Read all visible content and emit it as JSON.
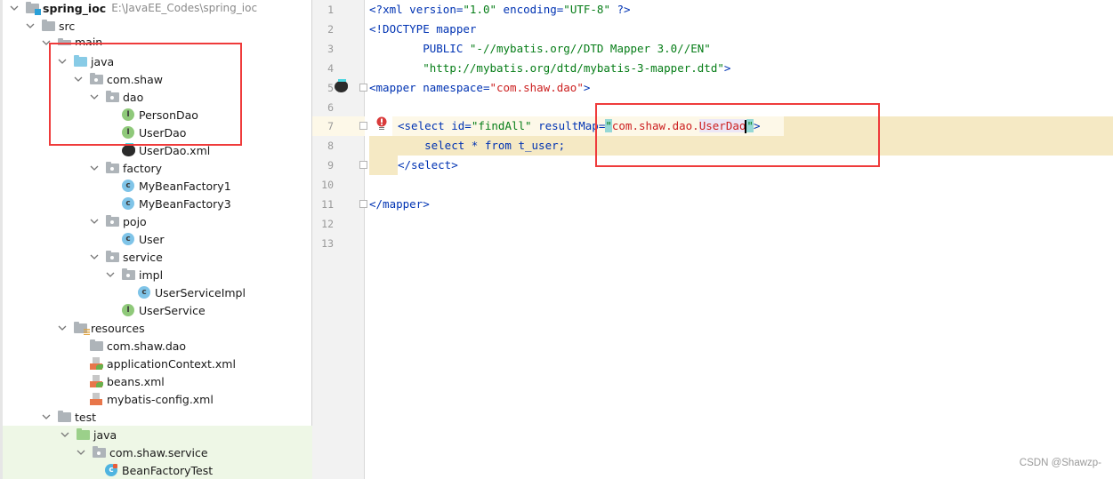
{
  "project_tree": {
    "root": {
      "name": "spring_ioc",
      "path": "E:\\JavaEE_Codes\\spring_ioc"
    },
    "items": [
      {
        "label": "src",
        "icon": "folder-icon",
        "level": 1
      },
      {
        "label": "main",
        "icon": "folder-icon",
        "level": 2
      },
      {
        "label": "java",
        "icon": "source-folder-icon",
        "level": 3
      },
      {
        "label": "com.shaw",
        "icon": "package-icon",
        "level": 4
      },
      {
        "label": "dao",
        "icon": "package-icon",
        "level": 5
      },
      {
        "label": "PersonDao",
        "icon": "interface-icon",
        "level": 6
      },
      {
        "label": "UserDao",
        "icon": "interface-icon",
        "level": 6
      },
      {
        "label": "UserDao.xml",
        "icon": "mybatis-xml-icon",
        "level": 6
      },
      {
        "label": "factory",
        "icon": "package-icon",
        "level": 5
      },
      {
        "label": "MyBeanFactory1",
        "icon": "class-icon",
        "level": 6
      },
      {
        "label": "MyBeanFactory3",
        "icon": "class-icon",
        "level": 6
      },
      {
        "label": "pojo",
        "icon": "package-icon",
        "level": 5
      },
      {
        "label": "User",
        "icon": "class-icon",
        "level": 6
      },
      {
        "label": "service",
        "icon": "package-icon",
        "level": 5
      },
      {
        "label": "impl",
        "icon": "package-icon",
        "level": 6
      },
      {
        "label": "UserServiceImpl",
        "icon": "class-icon",
        "level": 7
      },
      {
        "label": "UserService",
        "icon": "interface-icon",
        "level": 6
      },
      {
        "label": "resources",
        "icon": "resources-folder-icon",
        "level": 3
      },
      {
        "label": "com.shaw.dao",
        "icon": "folder-icon",
        "level": 4
      },
      {
        "label": "applicationContext.xml",
        "icon": "spring-xml-icon",
        "level": 4
      },
      {
        "label": "beans.xml",
        "icon": "spring-xml-icon",
        "level": 4
      },
      {
        "label": "mybatis-config.xml",
        "icon": "xml-icon",
        "level": 4
      },
      {
        "label": "test",
        "icon": "folder-icon",
        "level": 2
      },
      {
        "label": "java",
        "icon": "test-folder-icon",
        "level": 3
      },
      {
        "label": "com.shaw.service",
        "icon": "package-icon",
        "level": 4
      },
      {
        "label": "BeanFactoryTest",
        "icon": "test-class-icon",
        "level": 5
      }
    ],
    "badge_letters": {
      "interface": "I",
      "class": "c"
    }
  },
  "editor": {
    "line_numbers": [
      "1",
      "2",
      "3",
      "4",
      "5",
      "6",
      "7",
      "8",
      "9",
      "10",
      "11",
      "12",
      "13"
    ],
    "lines": {
      "l1": {
        "a": "<?",
        "b": "xml version",
        "c": "=",
        "d": "\"1.0\"",
        "e": " encoding",
        "f": "=",
        "g": "\"UTF-8\"",
        "h": " ?>"
      },
      "l2": {
        "a": "<!DOCTYPE mapper"
      },
      "l3": {
        "a": "        PUBLIC ",
        "b": "\"-//mybatis.org//DTD Mapper 3.0//EN\""
      },
      "l4": {
        "a": "        ",
        "b": "\"http://mybatis.org/dtd/mybatis-3-mapper.dtd\"",
        "c": ">"
      },
      "l5": {
        "a": "<mapper ",
        "b": "namespace",
        "c": "=",
        "d": "\"com.shaw.dao\"",
        "e": ">"
      },
      "l7": {
        "a": "<select ",
        "b": "id",
        "c": "=",
        "d": "\"findAll\"",
        "e": " resultMap",
        "f": "=",
        "q1": "\"",
        "g": "com.shaw.dao.",
        "h": "UserDao",
        "q2": "\"",
        "i": ">"
      },
      "l8": {
        "a": "    select * from t_user;"
      },
      "l9": {
        "a": "</select>"
      },
      "l11": {
        "a": "</mapper>"
      }
    }
  },
  "watermark": "CSDN @Shawzp-"
}
